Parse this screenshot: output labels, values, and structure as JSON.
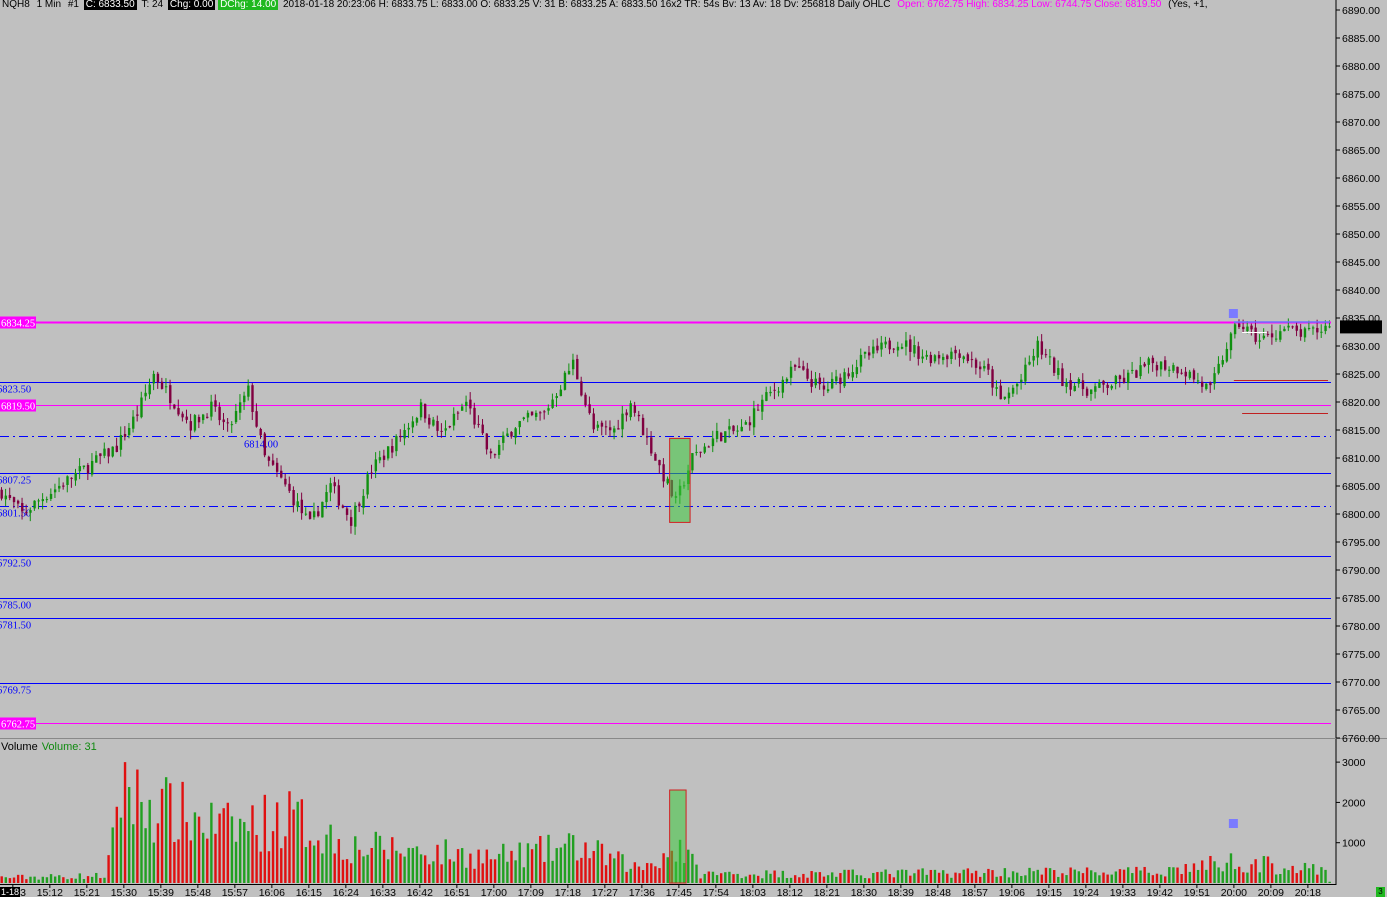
{
  "header": {
    "symbol": "NQH8",
    "interval": "1 Min",
    "plus": "#1",
    "c_box": "C: 6833.50",
    "t_label": "T: 24",
    "chg_box": "Chg: 0.00",
    "dchg_box": "DChg: 14.00",
    "details": "2018-01-18  20:23:06  H: 6833.75  L: 6833.00  O: 6833.25  V: 31  B: 6833.25  A: 6833.50  16x2  TR: 54s  Bv: 13  Av: 18  Dv: 256818  Daily OHLC",
    "daily": "Open: 6762.75  High: 6834.25  Low: 6744.75  Close: 6819.50",
    "tail": "(Yes, +1,"
  },
  "price_axis": {
    "ticks": [
      "6890.00",
      "6885.00",
      "6880.00",
      "6875.00",
      "6870.00",
      "6865.00",
      "6860.00",
      "6855.00",
      "6850.00",
      "6845.00",
      "6840.00",
      "6835.00",
      "6830.00",
      "6825.00",
      "6820.00",
      "6815.00",
      "6810.00",
      "6805.00",
      "6800.00",
      "6795.00",
      "6790.00",
      "6785.00",
      "6780.00",
      "6775.00",
      "6770.00",
      "6765.00",
      "6760.00"
    ],
    "last_price_box": "6833.50"
  },
  "volume_axis": {
    "ticks": [
      "3000",
      "2000",
      "1000"
    ]
  },
  "time_axis": {
    "labels": [
      "15:03",
      "15:12",
      "15:21",
      "15:30",
      "15:39",
      "15:48",
      "15:57",
      "16:06",
      "16:15",
      "16:24",
      "16:33",
      "16:42",
      "16:51",
      "17:00",
      "17:09",
      "17:18",
      "17:27",
      "17:36",
      "17:45",
      "17:54",
      "18:03",
      "18:12",
      "18:21",
      "18:30",
      "18:39",
      "18:48",
      "18:57",
      "19:06",
      "19:15",
      "19:24",
      "19:33",
      "19:42",
      "19:51",
      "20:00",
      "20:09",
      "20:18"
    ],
    "corner_date": "1-18",
    "corner_badge": "3"
  },
  "level_lines": [
    {
      "price": 6834.25,
      "label": "6834.25",
      "style": "box",
      "color": "#ff00ff"
    },
    {
      "price": 6823.5,
      "label": "6823.50",
      "style": "text",
      "color": "#0000ff"
    },
    {
      "price": 6819.5,
      "label": "6819.50",
      "style": "box",
      "color": "#ff00ff"
    },
    {
      "price": 6814.0,
      "label": "6814.00",
      "style": "dashdot",
      "color": "#0000ff"
    },
    {
      "price": 6807.25,
      "label": "6807.25",
      "style": "text",
      "color": "#0000ff"
    },
    {
      "price": 6801.5,
      "label": "6801.50",
      "style": "dashdot",
      "color": "#0000ff"
    },
    {
      "price": 6792.5,
      "label": "6792.50",
      "style": "text",
      "color": "#0000ff"
    },
    {
      "price": 6785.0,
      "label": "6785.00",
      "style": "text",
      "color": "#0000ff"
    },
    {
      "price": 6781.5,
      "label": "6781.50",
      "style": "text",
      "color": "#0000ff"
    },
    {
      "price": 6769.75,
      "label": "6769.75",
      "style": "text",
      "color": "#0000ff"
    },
    {
      "price": 6762.75,
      "label": "6762.75",
      "style": "box",
      "color": "#ff00ff"
    }
  ],
  "volume_panel": {
    "title": "Volume",
    "value_label": "Volume: 31"
  },
  "colors": {
    "up": "#109010",
    "down": "#800040",
    "vol_up": "#22a022",
    "vol_down": "#e01010",
    "background": "#c0c0c0"
  },
  "chart_data": {
    "type": "candlestick",
    "symbol": "NQH8",
    "interval": "1 Min",
    "ylim": [
      6760,
      6890
    ],
    "volume_ylim": [
      0,
      3400
    ],
    "close_path": [
      {
        "time": "15:00",
        "price": 6804.0
      },
      {
        "time": "15:05",
        "price": 6800.0
      },
      {
        "time": "15:10",
        "price": 6803.0
      },
      {
        "time": "15:20",
        "price": 6808.0
      },
      {
        "time": "15:28",
        "price": 6812.0
      },
      {
        "time": "15:33",
        "price": 6818.0
      },
      {
        "time": "15:37",
        "price": 6825.0
      },
      {
        "time": "15:42",
        "price": 6820.0
      },
      {
        "time": "15:46",
        "price": 6816.0
      },
      {
        "time": "15:51",
        "price": 6819.0
      },
      {
        "time": "15:55",
        "price": 6815.0
      },
      {
        "time": "16:00",
        "price": 6822.0
      },
      {
        "time": "16:04",
        "price": 6810.0
      },
      {
        "time": "16:09",
        "price": 6805.0
      },
      {
        "time": "16:15",
        "price": 6798.0
      },
      {
        "time": "16:20",
        "price": 6805.0
      },
      {
        "time": "16:25",
        "price": 6799.0
      },
      {
        "time": "16:30",
        "price": 6808.0
      },
      {
        "time": "16:36",
        "price": 6813.0
      },
      {
        "time": "16:42",
        "price": 6819.0
      },
      {
        "time": "16:47",
        "price": 6814.0
      },
      {
        "time": "16:53",
        "price": 6820.0
      },
      {
        "time": "16:59",
        "price": 6810.0
      },
      {
        "time": "17:05",
        "price": 6816.0
      },
      {
        "time": "17:12",
        "price": 6818.0
      },
      {
        "time": "17:19",
        "price": 6827.0
      },
      {
        "time": "17:24",
        "price": 6815.0
      },
      {
        "time": "17:29",
        "price": 6815.0
      },
      {
        "time": "17:33",
        "price": 6820.0
      },
      {
        "time": "17:39",
        "price": 6810.0
      },
      {
        "time": "17:44",
        "price": 6802.0
      },
      {
        "time": "17:48",
        "price": 6810.0
      },
      {
        "time": "17:54",
        "price": 6814.0
      },
      {
        "time": "18:00",
        "price": 6815.0
      },
      {
        "time": "18:05",
        "price": 6820.0
      },
      {
        "time": "18:13",
        "price": 6826.0
      },
      {
        "time": "18:20",
        "price": 6822.0
      },
      {
        "time": "18:30",
        "price": 6828.0
      },
      {
        "time": "18:38",
        "price": 6831.0
      },
      {
        "time": "18:45",
        "price": 6828.0
      },
      {
        "time": "18:53",
        "price": 6829.0
      },
      {
        "time": "19:00",
        "price": 6825.0
      },
      {
        "time": "19:03",
        "price": 6820.0
      },
      {
        "time": "19:08",
        "price": 6824.0
      },
      {
        "time": "19:12",
        "price": 6830.0
      },
      {
        "time": "19:18",
        "price": 6824.0
      },
      {
        "time": "19:25",
        "price": 6822.0
      },
      {
        "time": "19:33",
        "price": 6824.0
      },
      {
        "time": "19:40",
        "price": 6827.0
      },
      {
        "time": "19:47",
        "price": 6826.0
      },
      {
        "time": "19:54",
        "price": 6822.0
      },
      {
        "time": "19:58",
        "price": 6830.0
      },
      {
        "time": "20:01",
        "price": 6834.0
      },
      {
        "time": "20:06",
        "price": 6831.0
      },
      {
        "time": "20:12",
        "price": 6833.0
      },
      {
        "time": "20:17",
        "price": 6832.0
      },
      {
        "time": "20:23",
        "price": 6833.5
      }
    ],
    "volume_profile": [
      {
        "time": "15:00",
        "volume": 150
      },
      {
        "time": "15:25",
        "volume": 200
      },
      {
        "time": "15:30",
        "volume": 2400
      },
      {
        "time": "15:40",
        "volume": 2000
      },
      {
        "time": "15:55",
        "volume": 1500
      },
      {
        "time": "16:10",
        "volume": 1800
      },
      {
        "time": "16:25",
        "volume": 1000
      },
      {
        "time": "16:40",
        "volume": 900
      },
      {
        "time": "17:00",
        "volume": 700
      },
      {
        "time": "17:20",
        "volume": 1000
      },
      {
        "time": "17:35",
        "volume": 400
      },
      {
        "time": "17:45",
        "volume": 1000
      },
      {
        "time": "17:50",
        "volume": 250
      },
      {
        "time": "18:30",
        "volume": 250
      },
      {
        "time": "19:00",
        "volume": 300
      },
      {
        "time": "19:40",
        "volume": 300
      },
      {
        "time": "20:00",
        "volume": 600
      },
      {
        "time": "20:23",
        "volume": 300
      }
    ],
    "last_price": 6833.5,
    "highlight_start": "17:43",
    "highlight_end": "17:47"
  }
}
